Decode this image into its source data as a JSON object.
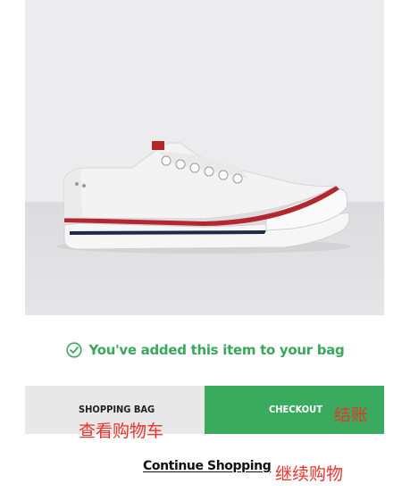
{
  "product": {
    "image_alt": "white-low-top-sneaker"
  },
  "confirmation": {
    "message": "You've added this item to your bag",
    "icon": "check-circle-icon",
    "color": "#3aa75c"
  },
  "actions": {
    "shopping_bag_label": "SHOPPING BAG",
    "shopping_bag_translation": "查看购物车",
    "checkout_label": "CHECKOUT",
    "checkout_translation": "结账",
    "checkout_color": "#3aab5e",
    "continue_label": "Continue Shopping",
    "continue_translation": "继续购物",
    "translation_color": "#e8342c"
  }
}
